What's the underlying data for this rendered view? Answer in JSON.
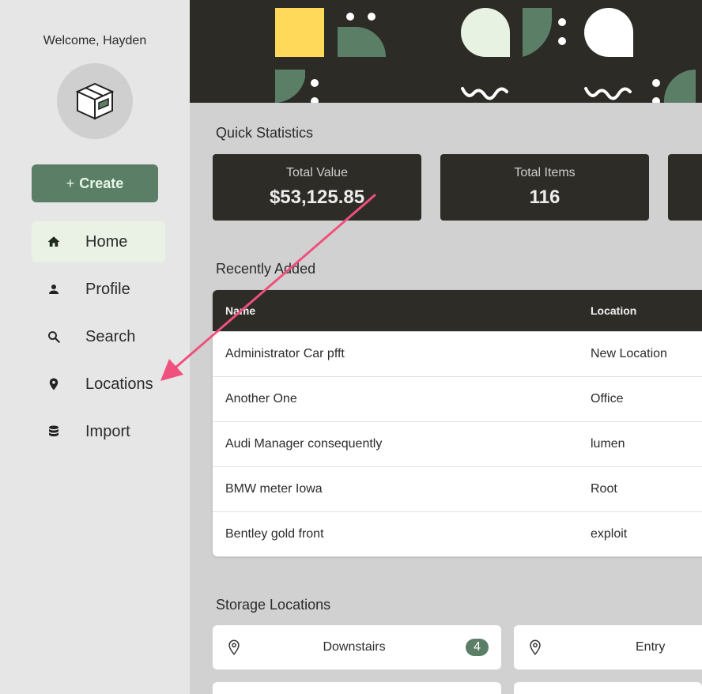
{
  "sidebar": {
    "welcome": "Welcome, Hayden",
    "create_label": "Create",
    "items": [
      {
        "label": "Home",
        "icon": "home-icon"
      },
      {
        "label": "Profile",
        "icon": "person-icon"
      },
      {
        "label": "Search",
        "icon": "search-icon"
      },
      {
        "label": "Locations",
        "icon": "map-pin-icon"
      },
      {
        "label": "Import",
        "icon": "database-icon"
      }
    ]
  },
  "quick_stats": {
    "title": "Quick Statistics",
    "cards": [
      {
        "label": "Total Value",
        "value": "$53,125.85"
      },
      {
        "label": "Total Items",
        "value": "116"
      }
    ]
  },
  "recent": {
    "title": "Recently Added",
    "columns": [
      "Name",
      "Location"
    ],
    "rows": [
      {
        "name": "Administrator Car pfft",
        "location": "New Location"
      },
      {
        "name": "Another One",
        "location": "Office"
      },
      {
        "name": "Audi Manager consequently",
        "location": "lumen"
      },
      {
        "name": "BMW meter Iowa",
        "location": "Root"
      },
      {
        "name": "Bentley gold front",
        "location": "exploit"
      }
    ]
  },
  "storage": {
    "title": "Storage Locations",
    "locations": [
      {
        "name": "Downstairs",
        "count": "4"
      },
      {
        "name": "Entry",
        "count": ""
      }
    ]
  },
  "colors": {
    "accent": "#5b7f66",
    "dark": "#2d2c27",
    "annotation_arrow": "#f0507e"
  }
}
